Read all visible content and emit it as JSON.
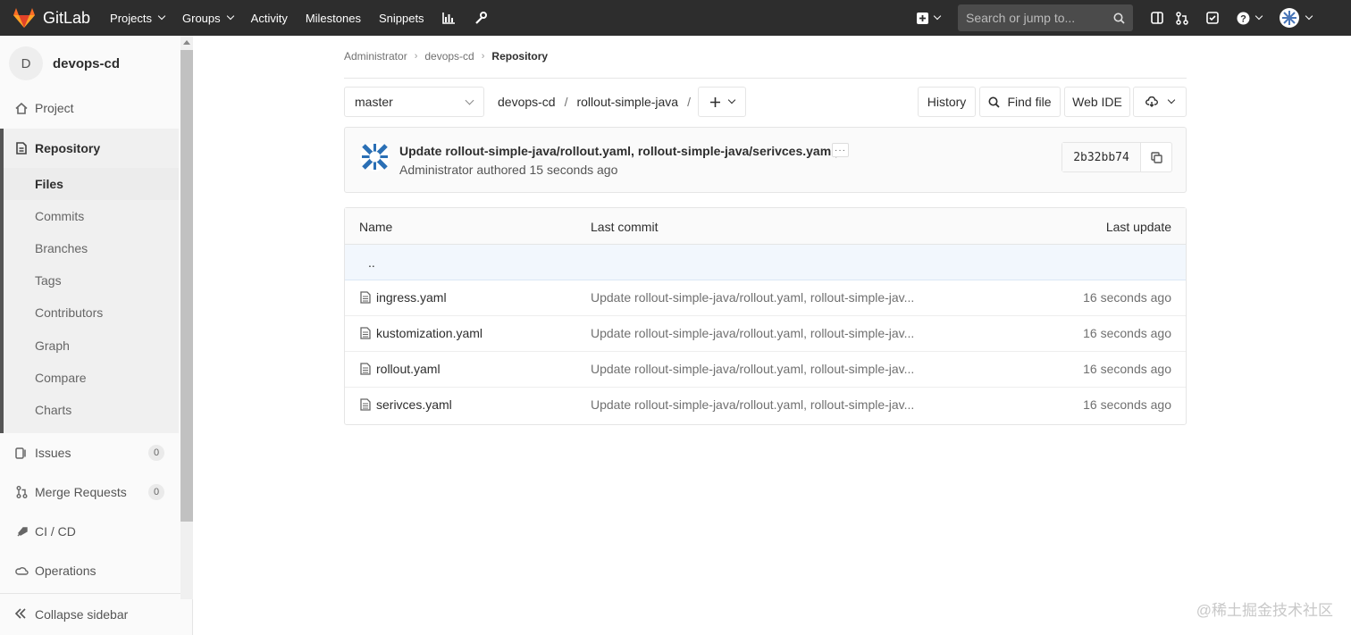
{
  "topbar": {
    "brand": "GitLab",
    "nav": [
      {
        "label": "Projects",
        "dropdown": true
      },
      {
        "label": "Groups",
        "dropdown": true
      },
      {
        "label": "Activity",
        "dropdown": false
      },
      {
        "label": "Milestones",
        "dropdown": false
      },
      {
        "label": "Snippets",
        "dropdown": false
      }
    ],
    "search_placeholder": "Search or jump to...",
    "colors": {
      "background": "#2d2d2d",
      "logo_orange": "#fc6d26",
      "logo_red": "#e24329"
    }
  },
  "sidebar": {
    "project_initial": "D",
    "project_name": "devops-cd",
    "project_label": "Project",
    "repository_label": "Repository",
    "repository_items": [
      "Files",
      "Commits",
      "Branches",
      "Tags",
      "Contributors",
      "Graph",
      "Compare",
      "Charts"
    ],
    "issues": {
      "label": "Issues",
      "count": "0"
    },
    "merge_requests": {
      "label": "Merge Requests",
      "count": "0"
    },
    "cicd_label": "CI / CD",
    "operations_label": "Operations",
    "collapse_label": "Collapse sidebar"
  },
  "breadcrumb": {
    "items": [
      "Administrator",
      "devops-cd",
      "Repository"
    ]
  },
  "toolbar": {
    "branch": "master",
    "path": [
      "devops-cd",
      "rollout-simple-java"
    ],
    "history": "History",
    "find_file": "Find file",
    "web_ide": "Web IDE"
  },
  "commit": {
    "title": "Update rollout-simple-java/rollout.yaml, rollout-simple-java/serivces.yaml,...",
    "author_line": "Administrator authored 15 seconds ago",
    "ellipsis": "···",
    "sha": "2b32bb74"
  },
  "tree": {
    "headers": {
      "name": "Name",
      "last_commit": "Last commit",
      "last_update": "Last update"
    },
    "parent": "..",
    "rows": [
      {
        "name": "ingress.yaml",
        "commit": "Update rollout-simple-java/rollout.yaml, rollout-simple-jav...",
        "updated": "16 seconds ago"
      },
      {
        "name": "kustomization.yaml",
        "commit": "Update rollout-simple-java/rollout.yaml, rollout-simple-jav...",
        "updated": "16 seconds ago"
      },
      {
        "name": "rollout.yaml",
        "commit": "Update rollout-simple-java/rollout.yaml, rollout-simple-jav...",
        "updated": "16 seconds ago"
      },
      {
        "name": "serivces.yaml",
        "commit": "Update rollout-simple-java/rollout.yaml, rollout-simple-jav...",
        "updated": "16 seconds ago"
      }
    ]
  },
  "watermark": "@稀土掘金技术社区"
}
